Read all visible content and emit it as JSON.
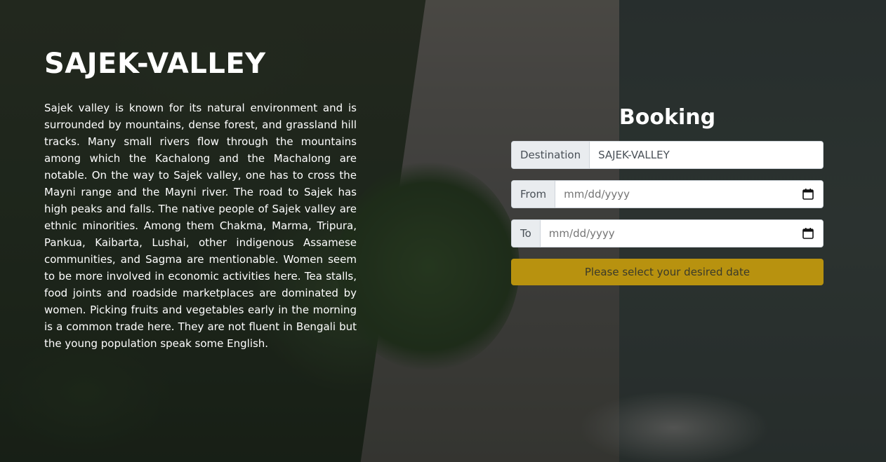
{
  "hero": {
    "title": "SAJEK-VALLEY",
    "description": "Sajek valley is known for its natural environment and is surrounded by mountains, dense forest, and grassland hill tracks. Many small rivers flow through the mountains among which the Kachalong and the Machalong are notable. On the way to Sajek valley, one has to cross the Mayni range and the Mayni river. The road to Sajek has high peaks and falls. The native people of Sajek valley are ethnic minorities. Among them Chakma, Marma, Tripura, Pankua, Kaibarta, Lushai, other indigenous Assamese communities, and Sagma are mentionable. Women seem to be more involved in economic activities here. Tea stalls, food joints and roadside marketplaces are dominated by women. Picking fruits and vegetables early in the morning is a common trade here. They are not fluent in Bengali but the young population speak some English."
  },
  "booking": {
    "title": "Booking",
    "destination": {
      "label": "Destination",
      "value": "SAJEK-VALLEY"
    },
    "from": {
      "label": "From",
      "placeholder": "mm/dd/yyyy",
      "icon": "calendar-icon"
    },
    "to": {
      "label": "To",
      "placeholder": "mm/dd/yyyy",
      "icon": "calendar-icon"
    },
    "submit_label": "Please select your desired date"
  },
  "colors": {
    "button": "#b8920f",
    "title_text": "#ffffff"
  }
}
